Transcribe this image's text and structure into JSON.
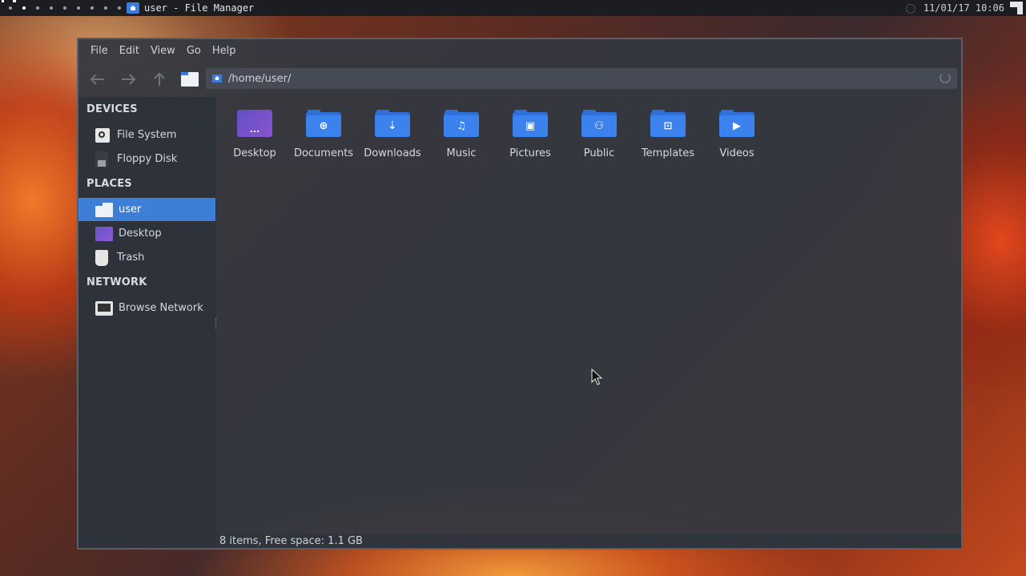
{
  "panel": {
    "workspace_count": 9,
    "active_workspace_index": 1,
    "task_title": "user - File Manager",
    "task_icon": "home-folder-icon",
    "clock": "11/01/17 10:06"
  },
  "window": {
    "menu": [
      "File",
      "Edit",
      "View",
      "Go",
      "Help"
    ],
    "toolbar": {
      "back_icon": "arrow-left-icon",
      "forward_icon": "arrow-right-icon",
      "up_icon": "arrow-up-icon",
      "home_icon": "home-folder-icon",
      "location": "/home/user/",
      "reload_icon": "reload-icon"
    },
    "sidebar": {
      "devices_header": "DEVICES",
      "devices": [
        {
          "label": "File System",
          "icon": "harddisk-icon"
        },
        {
          "label": "Floppy Disk",
          "icon": "floppy-icon"
        }
      ],
      "places_header": "PLACES",
      "places": [
        {
          "label": "user",
          "icon": "home-folder-icon",
          "selected": true
        },
        {
          "label": "Desktop",
          "icon": "desktop-icon",
          "selected": false
        },
        {
          "label": "Trash",
          "icon": "trash-icon",
          "selected": false
        }
      ],
      "network_header": "NETWORK",
      "network": [
        {
          "label": "Browse Network",
          "icon": "network-icon"
        }
      ]
    },
    "files": [
      {
        "label": "Desktop",
        "glyph": "...",
        "icon": "desktop-folder-icon"
      },
      {
        "label": "Documents",
        "glyph": "⊕",
        "icon": "documents-folder-icon"
      },
      {
        "label": "Downloads",
        "glyph": "⇣",
        "icon": "downloads-folder-icon"
      },
      {
        "label": "Music",
        "glyph": "♫",
        "icon": "music-folder-icon"
      },
      {
        "label": "Pictures",
        "glyph": "▣",
        "icon": "pictures-folder-icon"
      },
      {
        "label": "Public",
        "glyph": "⚇",
        "icon": "public-folder-icon"
      },
      {
        "label": "Templates",
        "glyph": "⊡",
        "icon": "templates-folder-icon"
      },
      {
        "label": "Videos",
        "glyph": "▶",
        "icon": "videos-folder-icon"
      }
    ],
    "status": "8 items, Free space: 1.1 GB"
  },
  "colors": {
    "selection": "#3d7fd6",
    "folder": "#3b82ee",
    "panel_bg": "#1b1d20"
  }
}
